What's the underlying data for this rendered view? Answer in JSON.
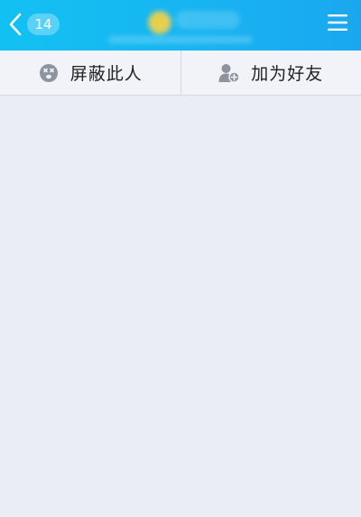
{
  "header": {
    "unread_count": "14",
    "colors": {
      "gradient_start": "#13c1f3",
      "gradient_end": "#1aa7ee"
    },
    "icons": {
      "back": "chevron-left-icon",
      "menu": "hamburger-menu-icon"
    }
  },
  "actions": [
    {
      "label": "屏蔽此人",
      "icon": "block-face-icon"
    },
    {
      "label": "加为好友",
      "icon": "add-friend-icon"
    }
  ],
  "colors": {
    "background": "#ebedf5",
    "action_bar": "#f2f3f8",
    "icon_gray": "#8f939e",
    "text": "#222222"
  }
}
